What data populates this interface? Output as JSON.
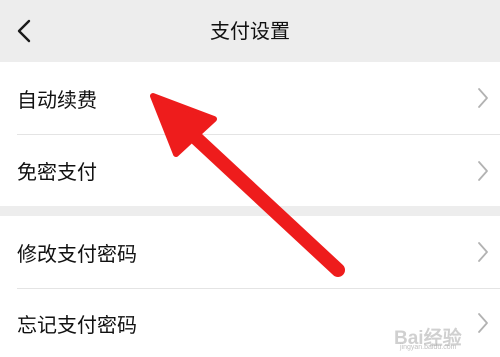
{
  "header": {
    "title": "支付设置",
    "back_icon": "back-chevron-icon"
  },
  "groups": [
    {
      "items": [
        {
          "label": "自动续费",
          "icon": "chevron-right-icon"
        },
        {
          "label": "免密支付",
          "icon": "chevron-right-icon"
        }
      ]
    },
    {
      "items": [
        {
          "label": "修改支付密码",
          "icon": "chevron-right-icon"
        },
        {
          "label": "忘记支付密码",
          "icon": "chevron-right-icon"
        }
      ]
    }
  ],
  "annotation": {
    "type": "red-arrow",
    "color": "#ee1c1c",
    "points_to": "自动续费"
  },
  "watermark": {
    "text": "Bai经验",
    "subtext": "jingyan.baidu.com"
  },
  "colors": {
    "background": "#ededed",
    "surface": "#ffffff",
    "text": "#111111",
    "chevron": "#b2b2b2",
    "arrow": "#ee1c1c"
  }
}
